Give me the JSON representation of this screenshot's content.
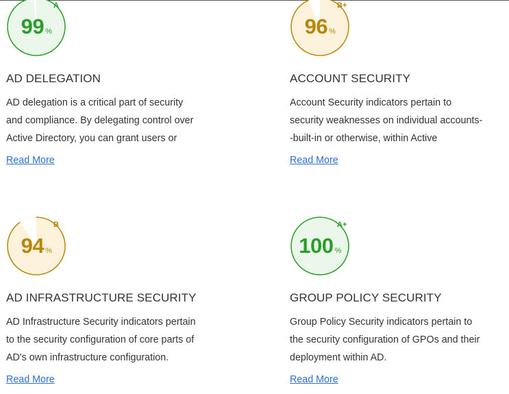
{
  "cards": [
    {
      "score": "99",
      "pct": "%",
      "grade": "A",
      "title": "AD DELEGATION",
      "description": [
        "AD delegation is a critical part of security",
        "and compliance. By delegating control over",
        "Active Directory, you can grant users or"
      ],
      "read_more": "Read More",
      "score_fraction": 0.99,
      "color": "#2a9d2a",
      "fill": "#eaf7ea"
    },
    {
      "score": "96",
      "pct": "%",
      "grade": "B+",
      "title": "ACCOUNT SECURITY",
      "description": [
        "Account Security indicators pertain to",
        "security weaknesses on individual accounts-",
        "-built-in or otherwise, within Active"
      ],
      "read_more": "Read More",
      "score_fraction": 0.96,
      "color": "#b8860b",
      "fill": "#fdf3dc"
    },
    {
      "score": "94",
      "pct": "%",
      "grade": "B",
      "title": "AD INFRASTRUCTURE SECURITY",
      "description": [
        "AD Infrastructure Security indicators pertain",
        "to the security configuration of core parts of",
        "AD's own infrastructure configuration."
      ],
      "read_more": "Read More",
      "score_fraction": 0.94,
      "color": "#b8860b",
      "fill": "#fdf3dc"
    },
    {
      "score": "100",
      "pct": "%",
      "grade": "A+",
      "title": "GROUP POLICY SECURITY",
      "description": [
        "Group Policy Security indicators pertain to",
        "the security configuration of GPOs and their",
        "deployment within AD."
      ],
      "read_more": "Read More",
      "score_fraction": 1.0,
      "color": "#2a9d2a",
      "fill": "#eaf7ea"
    }
  ]
}
